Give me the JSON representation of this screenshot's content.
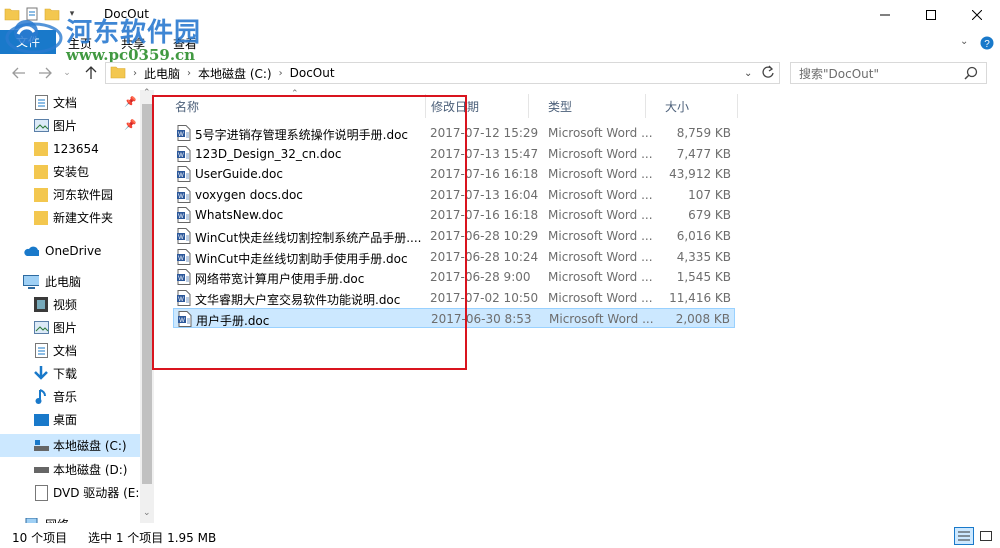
{
  "window": {
    "title": "DocOut"
  },
  "ribbon": {
    "file": "文件",
    "tabs": [
      "主页",
      "共享",
      "查看"
    ]
  },
  "watermark": {
    "title": "河东软件园",
    "url": "www.pc0359.cn"
  },
  "address": {
    "crumbs": [
      "此电脑",
      "本地磁盘 (C:)",
      "DocOut"
    ]
  },
  "search": {
    "placeholder": "搜索\"DocOut\""
  },
  "sidebar": {
    "items": [
      {
        "label": "文档",
        "icon": "document-folder-icon",
        "pinned": true
      },
      {
        "label": "图片",
        "icon": "pictures-folder-icon",
        "pinned": true
      },
      {
        "label": "123654",
        "icon": "folder-icon"
      },
      {
        "label": "安装包",
        "icon": "folder-icon"
      },
      {
        "label": "河东软件园",
        "icon": "folder-icon"
      },
      {
        "label": "新建文件夹",
        "icon": "folder-icon"
      },
      {
        "label": "OneDrive",
        "icon": "cloud-icon"
      },
      {
        "label": "此电脑",
        "icon": "computer-icon"
      },
      {
        "label": "视频",
        "icon": "video-folder-icon"
      },
      {
        "label": "图片",
        "icon": "pictures-folder-icon"
      },
      {
        "label": "文档",
        "icon": "document-folder-icon"
      },
      {
        "label": "下载",
        "icon": "download-arrow-icon"
      },
      {
        "label": "音乐",
        "icon": "music-note-icon"
      },
      {
        "label": "桌面",
        "icon": "desktop-icon"
      },
      {
        "label": "本地磁盘 (C:)",
        "icon": "windows-drive-icon",
        "selected": true
      },
      {
        "label": "本地磁盘 (D:)",
        "icon": "drive-icon"
      },
      {
        "label": "DVD 驱动器 (E:)",
        "icon": "dvd-drive-icon"
      },
      {
        "label": "网络",
        "icon": "network-icon"
      }
    ]
  },
  "columns": [
    "名称",
    "修改日期",
    "类型",
    "大小"
  ],
  "files": [
    {
      "name": "5号字进销存管理系统操作说明手册.doc",
      "date": "2017-07-12 15:29",
      "type": "Microsoft Word ...",
      "size": "8,759 KB"
    },
    {
      "name": "123D_Design_32_cn.doc",
      "date": "2017-07-13 15:47",
      "type": "Microsoft Word ...",
      "size": "7,477 KB"
    },
    {
      "name": "UserGuide.doc",
      "date": "2017-07-16 16:18",
      "type": "Microsoft Word ...",
      "size": "43,912 KB"
    },
    {
      "name": "voxygen docs.doc",
      "date": "2017-07-13 16:04",
      "type": "Microsoft Word ...",
      "size": "107 KB"
    },
    {
      "name": "WhatsNew.doc",
      "date": "2017-07-16 16:18",
      "type": "Microsoft Word ...",
      "size": "679 KB"
    },
    {
      "name": "WinCut快走丝线切割控制系统产品手册....",
      "date": "2017-06-28 10:29",
      "type": "Microsoft Word ...",
      "size": "6,016 KB"
    },
    {
      "name": "WinCut中走丝线切割助手使用手册.doc",
      "date": "2017-06-28 10:24",
      "type": "Microsoft Word ...",
      "size": "4,335 KB"
    },
    {
      "name": "网络带宽计算用户使用手册.doc",
      "date": "2017-06-28 9:00",
      "type": "Microsoft Word ...",
      "size": "1,545 KB"
    },
    {
      "name": "文华睿期大户室交易软件功能说明.doc",
      "date": "2017-07-02 10:50",
      "type": "Microsoft Word ...",
      "size": "11,416 KB"
    },
    {
      "name": "用户手册.doc",
      "date": "2017-06-30 8:53",
      "type": "Microsoft Word ...",
      "size": "2,008 KB",
      "selected": true
    }
  ],
  "status": {
    "count": "10 个项目",
    "selection": "选中 1 个项目  1.95 MB"
  },
  "colors": {
    "selection": "#cce8ff",
    "accent": "#1979ca",
    "highlight": "#d9141e"
  }
}
